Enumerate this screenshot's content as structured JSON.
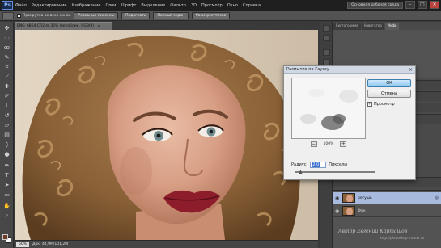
{
  "app": {
    "logo": "Ps",
    "menu": [
      "Файл",
      "Редактирование",
      "Изображение",
      "Слои",
      "Шрифт",
      "Выделение",
      "Фильтр",
      "3D",
      "Просмотр",
      "Окно",
      "Справка"
    ],
    "workspace_label": "Основная рабочая среда",
    "window_controls": [
      "–",
      "□",
      "×"
    ]
  },
  "options": {
    "checkbox_label": "Прокрутка во всех окнах",
    "buttons": [
      "Реальные пикселы",
      "Подогнать",
      "Полный экран",
      "Размер оттиска"
    ]
  },
  "document": {
    "tab_title": "ENG_6864.CR2 @ 36% (эктоблик, RGB/8)",
    "close": "×",
    "zoom": "50%",
    "doc_size": "Док: 44,9M/101,2M"
  },
  "dialog": {
    "title": "Размытие по Гауссу",
    "close": "×",
    "ok_label": "ОК",
    "cancel_label": "Отмена",
    "preview_label": "Просмотр",
    "preview_checked": "✓",
    "zoom_minus": "−",
    "zoom_plus": "+",
    "zoom_percent": "100%",
    "radius_label": "Радиус:",
    "radius_value": "2,0",
    "radius_units": "Пикселы",
    "slider_position": 0.04
  },
  "panels": {
    "tabs": [
      "Гистограмма",
      "Навигатор",
      "Инфо"
    ],
    "active_tab": "Инфо",
    "layers": [
      {
        "name": "ретушь",
        "fx": "◎",
        "selected": true
      },
      {
        "name": "Фон",
        "fx": "",
        "selected": false
      }
    ]
  },
  "watermark": {
    "line1": "Автор Евгений Карташов",
    "line2": "http://photoshop-master.ru"
  },
  "colors": {
    "menubar": "#1f1f1f",
    "ok_button": "#8ec8ef",
    "selected_layer": "#a7b9dd",
    "foreground": "#6b3a2a",
    "background": "#ffffff"
  },
  "icons": [
    "move-icon",
    "marquee-icon",
    "lasso-icon",
    "quick-select-icon",
    "crop-icon",
    "eyedropper-icon",
    "healing-icon",
    "brush-icon",
    "stamp-icon",
    "history-brush-icon",
    "eraser-icon",
    "gradient-icon",
    "blur-icon",
    "dodge-icon",
    "pen-icon",
    "type-icon",
    "path-select-icon",
    "shape-icon",
    "hand-icon",
    "zoom-icon"
  ]
}
